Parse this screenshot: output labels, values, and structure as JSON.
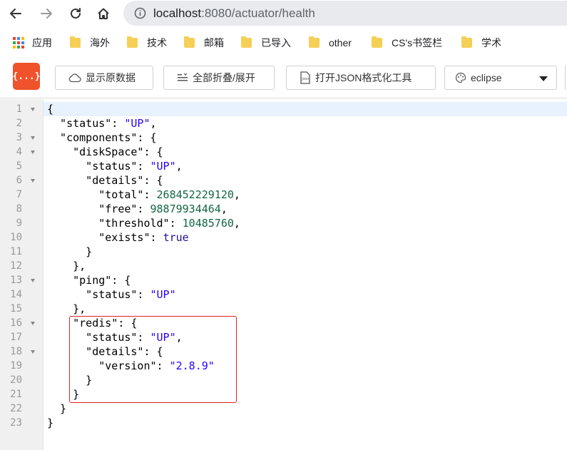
{
  "browser": {
    "url_host": "localhost",
    "url_path": ":8080/actuator/health",
    "back_icon": "arrow-left-icon",
    "forward_icon": "arrow-right-icon",
    "reload_icon": "reload-icon",
    "home_icon": "home-icon"
  },
  "bookmarks": [
    {
      "label": "应用",
      "icon": "apps-icon"
    },
    {
      "label": "海外",
      "icon": "folder-icon"
    },
    {
      "label": "技术",
      "icon": "folder-icon"
    },
    {
      "label": "邮箱",
      "icon": "folder-icon"
    },
    {
      "label": "已导入",
      "icon": "folder-icon"
    },
    {
      "label": "other",
      "icon": "folder-icon"
    },
    {
      "label": "CS's书签栏",
      "icon": "folder-icon"
    },
    {
      "label": "学术",
      "icon": "folder-icon"
    }
  ],
  "toolbar": {
    "logo_text": "{...}",
    "raw_label": "显示原数据",
    "fold_label": "全部折叠/展开",
    "json_tool_label": "打开JSON格式化工具",
    "theme_value": "eclipse",
    "colors": {
      "logo": "#f0522b",
      "string": "#2a00ff",
      "number": "#116644",
      "keyword": "#221199",
      "highlight": "#e02020"
    }
  },
  "editor": {
    "line_numbers": [
      "1",
      "2",
      "3",
      "4",
      "5",
      "6",
      "7",
      "8",
      "9",
      "10",
      "11",
      "12",
      "13",
      "14",
      "15",
      "16",
      "17",
      "18",
      "19",
      "20",
      "21",
      "22",
      "23"
    ],
    "foldable_lines": [
      1,
      3,
      4,
      6,
      13,
      16,
      18
    ],
    "lines": [
      [
        {
          "t": "{",
          "c": "p"
        }
      ],
      [
        {
          "t": "  \"status\": ",
          "c": "p"
        },
        {
          "t": "\"UP\"",
          "c": "s"
        },
        {
          "t": ",",
          "c": "p"
        }
      ],
      [
        {
          "t": "  \"components\": {",
          "c": "p"
        }
      ],
      [
        {
          "t": "    \"diskSpace\": {",
          "c": "p"
        }
      ],
      [
        {
          "t": "      \"status\": ",
          "c": "p"
        },
        {
          "t": "\"UP\"",
          "c": "s"
        },
        {
          "t": ",",
          "c": "p"
        }
      ],
      [
        {
          "t": "      \"details\": {",
          "c": "p"
        }
      ],
      [
        {
          "t": "        \"total\": ",
          "c": "p"
        },
        {
          "t": "268452229120",
          "c": "n"
        },
        {
          "t": ",",
          "c": "p"
        }
      ],
      [
        {
          "t": "        \"free\": ",
          "c": "p"
        },
        {
          "t": "98879934464",
          "c": "n"
        },
        {
          "t": ",",
          "c": "p"
        }
      ],
      [
        {
          "t": "        \"threshold\": ",
          "c": "p"
        },
        {
          "t": "10485760",
          "c": "n"
        },
        {
          "t": ",",
          "c": "p"
        }
      ],
      [
        {
          "t": "        \"exists\": ",
          "c": "p"
        },
        {
          "t": "true",
          "c": "b"
        }
      ],
      [
        {
          "t": "      }",
          "c": "p"
        }
      ],
      [
        {
          "t": "    },",
          "c": "p"
        }
      ],
      [
        {
          "t": "    \"ping\": {",
          "c": "p"
        }
      ],
      [
        {
          "t": "      \"status\": ",
          "c": "p"
        },
        {
          "t": "\"UP\"",
          "c": "s"
        }
      ],
      [
        {
          "t": "    },",
          "c": "p"
        }
      ],
      [
        {
          "t": "    \"redis\": {",
          "c": "p"
        }
      ],
      [
        {
          "t": "      \"status\": ",
          "c": "p"
        },
        {
          "t": "\"UP\"",
          "c": "s"
        },
        {
          "t": ",",
          "c": "p"
        }
      ],
      [
        {
          "t": "      \"details\": {",
          "c": "p"
        }
      ],
      [
        {
          "t": "        \"version\": ",
          "c": "p"
        },
        {
          "t": "\"2.8.9\"",
          "c": "s"
        }
      ],
      [
        {
          "t": "      }",
          "c": "p"
        }
      ],
      [
        {
          "t": "    }",
          "c": "p"
        }
      ],
      [
        {
          "t": "  }",
          "c": "p"
        }
      ],
      [
        {
          "t": "}",
          "c": "p"
        }
      ]
    ]
  }
}
